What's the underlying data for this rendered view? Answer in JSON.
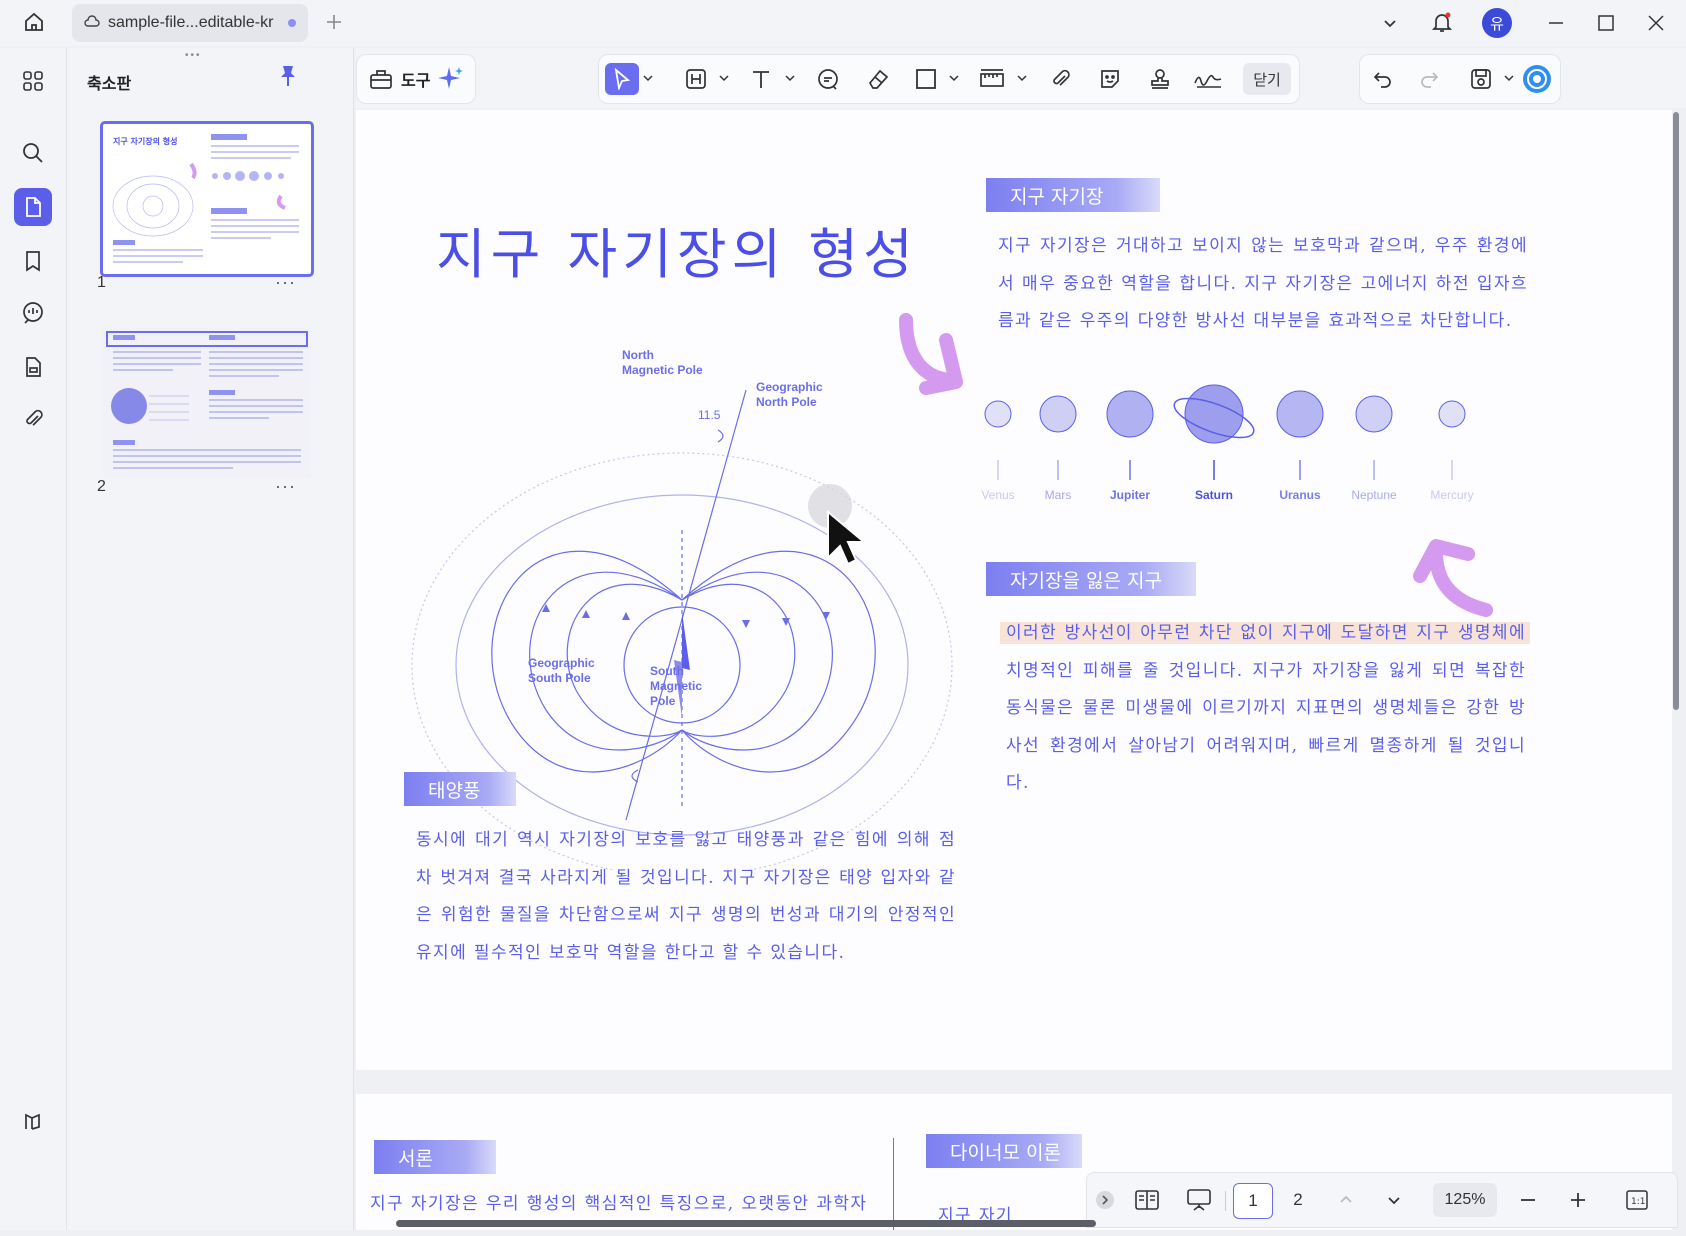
{
  "titlebar": {
    "tab_title": "sample-file...editable-kr",
    "avatar_initial": "유"
  },
  "panel": {
    "title": "축소판",
    "thumbs": [
      {
        "num": "1",
        "more": "···"
      },
      {
        "num": "2",
        "more": "···"
      }
    ]
  },
  "toolbar": {
    "tools_label": "도구",
    "close_label": "닫기"
  },
  "page": {
    "title": "지구 자기장의 형성",
    "sections": {
      "field": {
        "label": "지구 자기장",
        "text": "지구 자기장은 거대하고 보이지 않는 보호막과 같으며, 우주 환경에서 매우 중요한 역할을 합니다. 지구 자기장은 고에너지 하전 입자흐름과 같은 우주의 다양한 방사선 대부분을 효과적으로 차단합니다."
      },
      "lost": {
        "label": "자기장을 잃은 지구",
        "text": "이러한 방사선이 아무런 차단 없이 지구에 도달하면 지구 생명체에 치명적인 피해를 줄 것입니다. 지구가 자기장을 잃게 되면 복잡한 동식물은 물론 미생물에 이르기까지 지표면의 생명체들은 강한 방사선 환경에서 살아남기 어려워지며, 빠르게 멸종하게 될 것입니다."
      },
      "wind": {
        "label": "태양풍",
        "text": "동시에 대기 역시 자기장의 보호를 잃고 태양풍과 같은 힘에 의해 점차 벗겨져 결국 사라지게 될 것입니다. 지구 자기장은 태양 입자와 같은 위험한 물질을 차단함으로써 지구 생명의 번성과 대기의 안정적인 유지에 필수적인 보호막 역할을 한다고 할 수 있습니다."
      }
    },
    "planets": [
      {
        "name": "Venus",
        "color": "#c9c9ee"
      },
      {
        "name": "Mars",
        "color": "#a9a9ec"
      },
      {
        "name": "Jupiter",
        "color": "#6f72e6"
      },
      {
        "name": "Saturn",
        "color": "#4e51e0"
      },
      {
        "name": "Uranus",
        "color": "#7b7ee8"
      },
      {
        "name": "Neptune",
        "color": "#a9abef"
      },
      {
        "name": "Mercury",
        "color": "#c9caf0"
      }
    ],
    "diagram": {
      "north_magnetic": "North\nMagnetic Pole",
      "geo_north": "Geographic\nNorth Pole",
      "angle": "11.5",
      "geo_south": "Geographic\nSouth Pole",
      "south_magnetic": "South\nMagnetic\nPole"
    }
  },
  "page2": {
    "intro_label": "서론",
    "intro_text": "지구 자기장은 우리 행성의 핵심적인 특징으로, 오랫동안 과학자",
    "dynamo_label": "다이너모 이론",
    "dynamo_text": "지구 자기"
  },
  "pagenav": {
    "page1": "1",
    "page2": "2",
    "zoom": "125%"
  },
  "colors": {
    "accent": "#5b5ee8",
    "highlight": "#f6dcd0",
    "arrow": "#d49af0"
  }
}
